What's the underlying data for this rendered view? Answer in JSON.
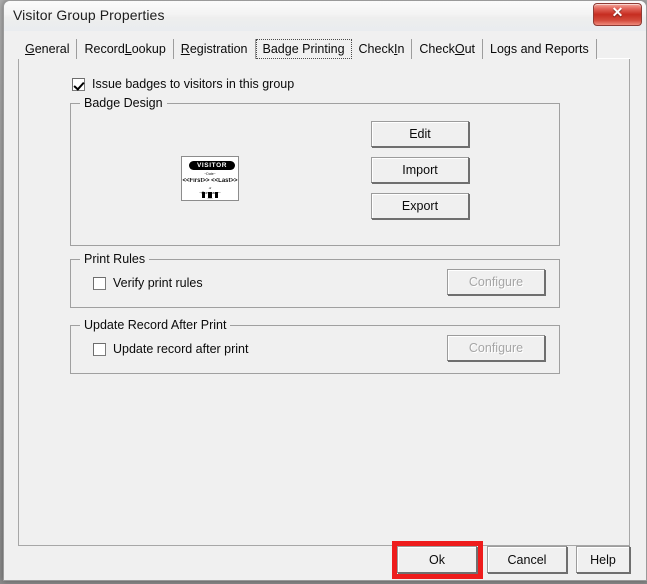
{
  "window": {
    "title": "Visitor Group Properties",
    "close_icon": "close-icon",
    "close_glyph": "✕"
  },
  "tabs": [
    {
      "label": "General",
      "pre": "",
      "accel": "G",
      "post": "eneral",
      "selected": false
    },
    {
      "label": "Record Lookup",
      "pre": "Record ",
      "accel": "L",
      "post": "ookup",
      "selected": false
    },
    {
      "label": "Registration",
      "pre": "",
      "accel": "R",
      "post": "egistration",
      "selected": false
    },
    {
      "label": "Badge Printing",
      "pre": "Badge Printing",
      "accel": "",
      "post": "",
      "selected": true
    },
    {
      "label": "Check In",
      "pre": "Check ",
      "accel": "I",
      "post": "n",
      "selected": false
    },
    {
      "label": "Check Out",
      "pre": "Check ",
      "accel": "O",
      "post": "ut",
      "selected": false
    },
    {
      "label": "Logs and Reports",
      "pre": "Lo",
      "accel": "g",
      "post": "s and Reports",
      "selected": false
    }
  ],
  "page": {
    "issue_badges": {
      "label": "Issue badges to visitors in this group",
      "checked": true
    },
    "badge_design": {
      "title": "Badge Design",
      "preview": {
        "banner": "VISITOR",
        "line1": "~Date~",
        "line2": "<<First>> <<Last>>",
        "line3": "of",
        "line4": "~Company~",
        "line5": "~V~"
      },
      "buttons": [
        {
          "label": "Edit",
          "disabled": false
        },
        {
          "label": "Import",
          "disabled": false
        },
        {
          "label": "Export",
          "disabled": false
        }
      ]
    },
    "print_rules": {
      "title": "Print Rules",
      "checkbox_label": "Verify print rules",
      "checked": false,
      "configure_label": "Configure",
      "configure_disabled": true
    },
    "update_record": {
      "title": "Update Record After Print",
      "checkbox_label": "Update record after print",
      "checked": false,
      "configure_label": "Configure",
      "configure_disabled": true
    }
  },
  "footer": {
    "ok": "Ok",
    "cancel": "Cancel",
    "help": "Help"
  },
  "annotation": {
    "highlight_color": "#ee1c1c",
    "target": "ok-button"
  }
}
